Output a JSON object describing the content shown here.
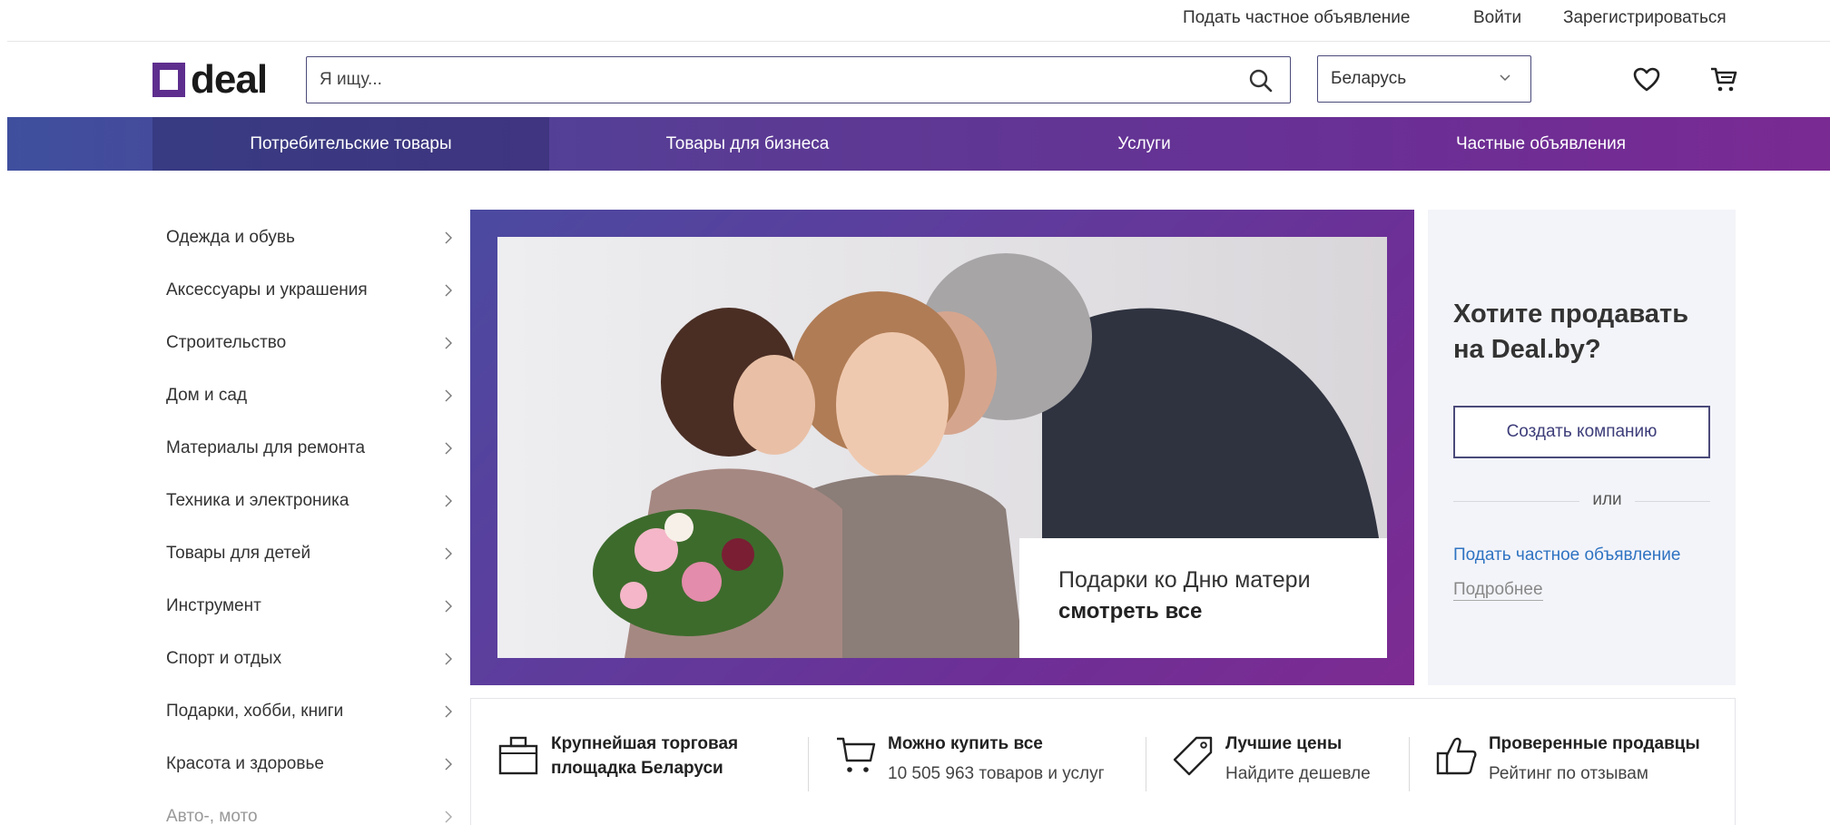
{
  "top_links": {
    "post_ad": "Подать частное объявление",
    "login": "Войти",
    "register": "Зарегистрироваться"
  },
  "header": {
    "logo_text": "deal",
    "search_placeholder": "Я ищу...",
    "country": "Беларусь"
  },
  "categories_nav": [
    "Потребительские товары",
    "Товары для бизнеса",
    "Услуги",
    "Частные объявления"
  ],
  "sidebar": [
    "Одежда и обувь",
    "Аксессуары и украшения",
    "Строительство",
    "Дом и сад",
    "Материалы для ремонта",
    "Техника и электроника",
    "Товары для детей",
    "Инструмент",
    "Спорт и отдых",
    "Подарки, хобби, книги",
    "Красота и здоровье",
    "Авто-, мото"
  ],
  "banner": {
    "caption_line1": "Подарки ко Дню матери",
    "caption_line2": "смотреть все"
  },
  "sell_panel": {
    "title": "Хотите продавать на Deal.by?",
    "create_button": "Создать компанию",
    "or": "или",
    "private_ad_link": "Подать частное объявление",
    "more_link": "Подробнее"
  },
  "features": [
    {
      "title": "Крупнейшая торговая",
      "sub": "площадка Беларуси",
      "icon": "briefcase-icon"
    },
    {
      "title": "Можно купить все",
      "sub": "10 505 963 товаров и услуг",
      "icon": "cart-icon"
    },
    {
      "title": "Лучшие цены",
      "sub": "Найдите дешевле",
      "icon": "price-tag-icon"
    },
    {
      "title": "Проверенные продавцы",
      "sub": "Рейтинг по отзывам",
      "icon": "thumbs-up-icon"
    }
  ],
  "colors": {
    "brand_purple": "#5e2e8e",
    "nav_gradient_start": "#3f4f9e",
    "nav_gradient_end": "#7a2a93",
    "link_blue": "#2f73c2"
  }
}
